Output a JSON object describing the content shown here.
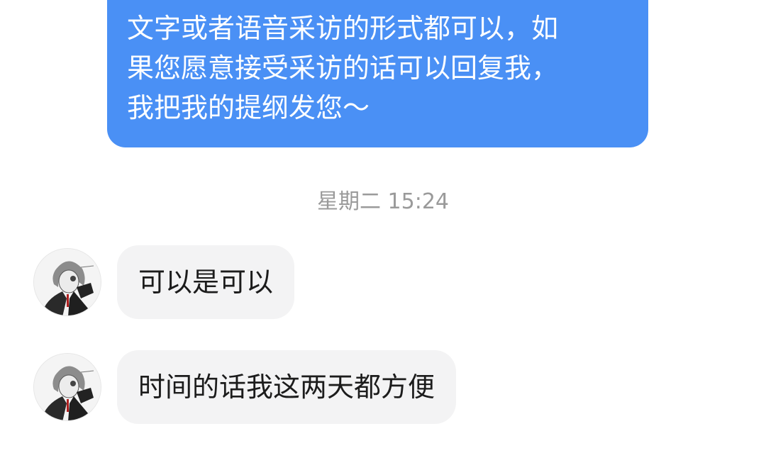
{
  "outgoing_message": {
    "lines": [
      "文字或者语音采访的形式都可以，如",
      "果您愿意接受采访的话可以回复我，",
      "我把我的提纲发您～"
    ]
  },
  "timestamp": "星期二 15:24",
  "incoming_messages": [
    {
      "text": "可以是可以"
    },
    {
      "text": "时间的话我这两天都方便"
    }
  ],
  "avatar_icon": "anime-character-avatar-icon",
  "colors": {
    "outgoing_bubble": "#4a90f5",
    "incoming_bubble": "#f3f3f4",
    "timestamp_text": "#9a9a9a",
    "background": "#ffffff"
  }
}
